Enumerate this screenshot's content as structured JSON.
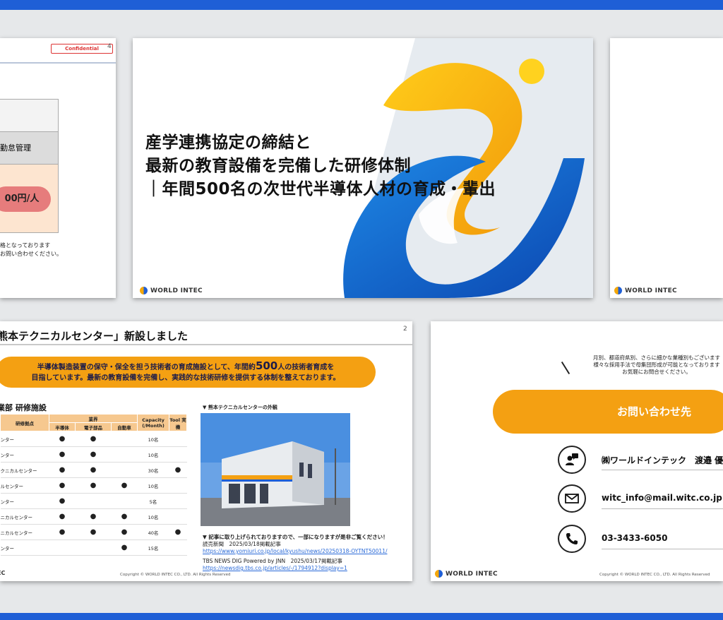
{
  "slide1": {
    "badge": "Confidential",
    "page": "4",
    "cell_label": "勤怠管理",
    "price": "00円/人",
    "note_lines": [
      "格となっております",
      "お問い合わせください。"
    ]
  },
  "slide2": {
    "title_lines": [
      "産学連携協定の締結と",
      "最新の教育設備を完備した研修体制",
      "｜年間500名の次世代半導体人材の育成・輩出"
    ],
    "logo": "WORLD INTEC"
  },
  "slide3": {
    "logo": "WORLD INTEC"
  },
  "slide4": {
    "heading": "熊本テクニカルセンター」新設しました",
    "page": "2",
    "banner_line1_a": "半導体製造装置の保守・保全を担う技術者の育成施設として、年間約",
    "banner_line1_num": "500",
    "banner_line1_b": "人の技術者育成を",
    "banner_line2": "目指しています。最新の教育設備を完備し、実践的な技術研修を提供する体制を整えております。",
    "section": "業部 研修施設",
    "table": {
      "header_site": "研修拠点",
      "header_industry": "業界",
      "sub_headers": [
        "半導体",
        "電子部品",
        "自動車"
      ],
      "header_capacity": "Capacity (/Month)",
      "header_tool": "Tool 実機",
      "rows": [
        {
          "name": "ンター",
          "semi": "●",
          "elec": "●",
          "auto": "",
          "cap": "10名",
          "tool": ""
        },
        {
          "name": "ンター",
          "semi": "●",
          "elec": "●",
          "auto": "",
          "cap": "10名",
          "tool": ""
        },
        {
          "name": "クニカルセンター",
          "semi": "●",
          "elec": "●",
          "auto": "",
          "cap": "30名",
          "tool": "●"
        },
        {
          "name": "ルセンター",
          "semi": "●",
          "elec": "●",
          "auto": "●",
          "cap": "10名",
          "tool": ""
        },
        {
          "name": "ンター",
          "semi": "●",
          "elec": "",
          "auto": "",
          "cap": "5名",
          "tool": ""
        },
        {
          "name": "ニカルセンター",
          "semi": "●",
          "elec": "●",
          "auto": "●",
          "cap": "10名",
          "tool": ""
        },
        {
          "name": "ニカルセンター",
          "semi": "●",
          "elec": "●",
          "auto": "●",
          "cap": "40名",
          "tool": "●"
        },
        {
          "name": "ンター",
          "semi": "",
          "elec": "",
          "auto": "●",
          "cap": "15名",
          "tool": ""
        }
      ]
    },
    "photo_caption": "▼ 熊本テクニカルセンターの外観",
    "article_note": "▼ 記事に取り上げられておりますので、一部になりますが是非ご覧ください！",
    "src1_label": "読売新聞　2025/03/18掲載記事",
    "src1_url": "https://www.yomiuri.co.jp/local/kyushu/news/20250318-OYTNT50011/",
    "src2_label": "TBS NEWS DIG Powered by JNN　2025/03/17掲載記事",
    "src2_url": "https://newsdig.tbs.co.jp/articles/-/1794912?display=1",
    "copyright": "Copyright © WORLD INTEC CO., LTD. All Rights Reserved",
    "logo_frag": "EC"
  },
  "slide5": {
    "top_lines": [
      "月別、都道府県別、さらに細かな業種別もございます",
      "様々な採用手法で母集団形成が可能となっております",
      "お気軽にお問合せください。"
    ],
    "contact_label": "お問い合わせ先",
    "company": "㈱ワールドインテック　渡邉 優",
    "email": "witc_info@mail.witc.co.jp",
    "phone": "03-3433-6050",
    "copyright": "Copyright © WORLD INTEC CO., LTD. All Rights Reserved",
    "logo": "WORLD INTEC"
  }
}
